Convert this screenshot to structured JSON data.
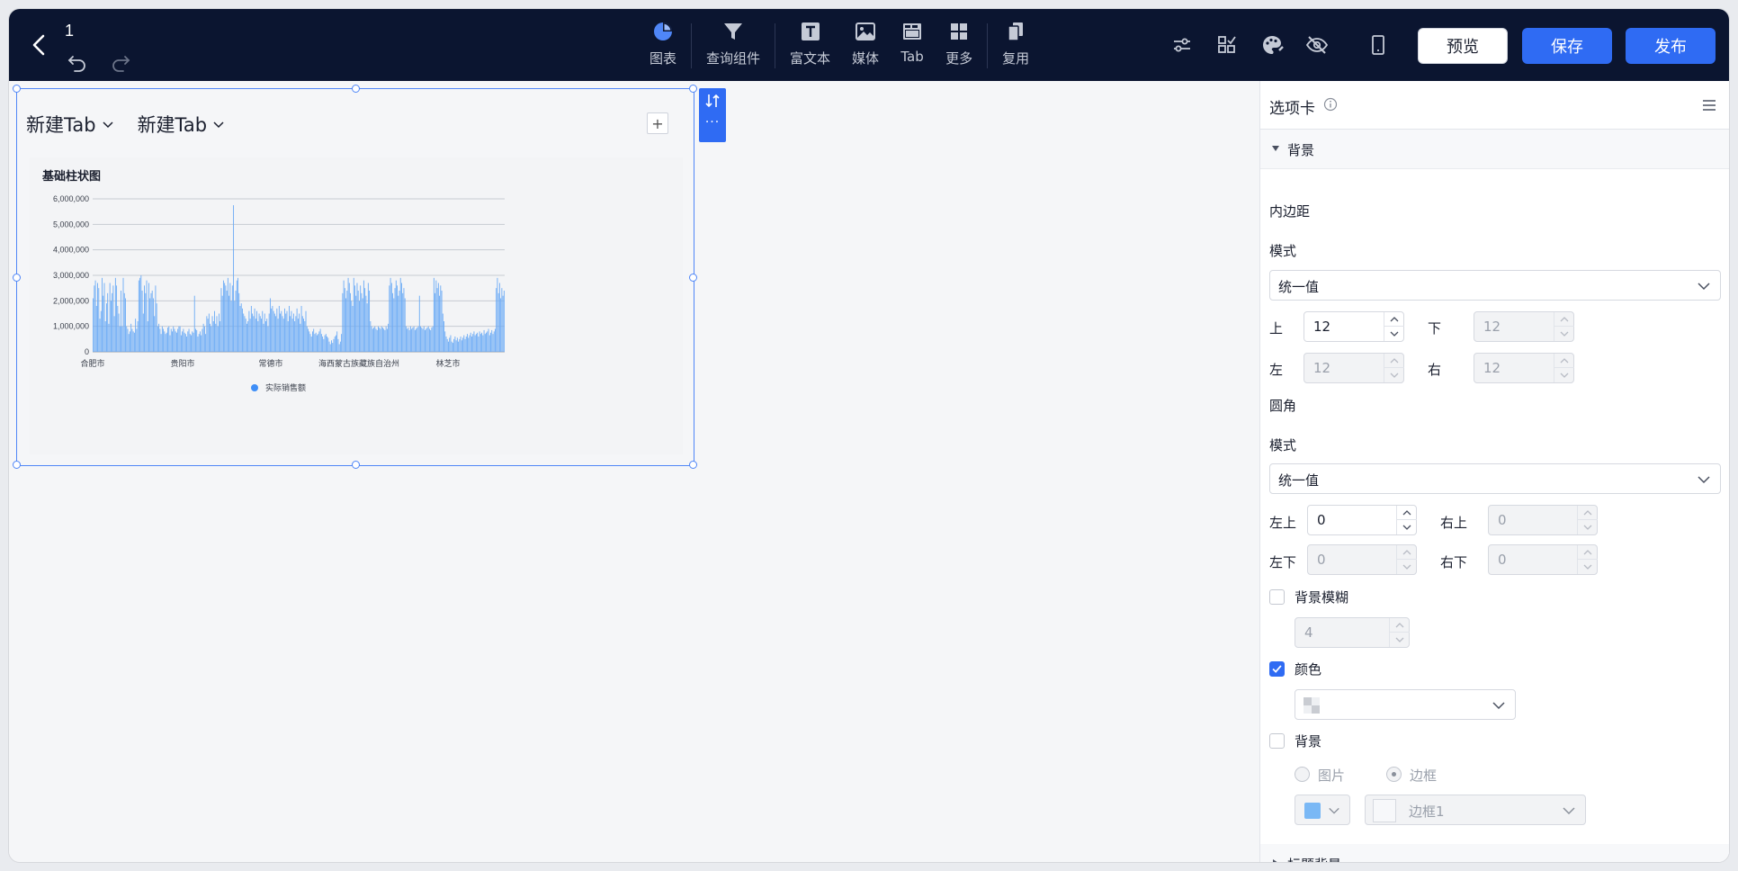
{
  "header": {
    "page_name": "1",
    "tools": [
      {
        "label": "图表",
        "icon": "pie-chart-icon"
      },
      {
        "label": "查询组件",
        "icon": "filter-icon"
      },
      {
        "label": "富文本",
        "icon": "text-icon"
      },
      {
        "label": "媒体",
        "icon": "image-icon"
      },
      {
        "label": "Tab",
        "icon": "tab-icon"
      },
      {
        "label": "更多",
        "icon": "grid-icon"
      },
      {
        "label": "复用",
        "icon": "copy-icon"
      }
    ],
    "preview_label": "预览",
    "save_label": "保存",
    "publish_label": "发布"
  },
  "canvas": {
    "tabs": [
      "新建Tab",
      "新建Tab"
    ],
    "add_tab": "+",
    "more_dots": "···"
  },
  "chart_data": {
    "type": "bar",
    "title": "基础柱状图",
    "xlabel": "",
    "ylabel": "",
    "ylim": [
      0,
      6000000
    ],
    "yticks": [
      "6,000,000",
      "5,000,000",
      "4,000,000",
      "3,000,000",
      "2,000,000",
      "1,000,000",
      "0"
    ],
    "xtick_labels": [
      "合肥市",
      "贵阳市",
      "常德市",
      "海西蒙古族藏族自治州",
      "林芝市"
    ],
    "legend": [
      {
        "name": "实际销售额",
        "color": "#3e8ef7"
      }
    ],
    "grid": true,
    "series": [
      {
        "name": "实际销售额",
        "color": "#6aaaf5",
        "values": [
          2100000,
          2600000,
          2800000,
          1800000,
          2700000,
          2500000,
          1300000,
          1600000,
          2900000,
          2200000,
          2700000,
          1200000,
          1900000,
          2300000,
          1100000,
          2700000,
          2000000,
          2300000,
          2600000,
          1400000,
          2900000,
          2600000,
          1800000,
          1500000,
          1000000,
          2400000,
          1000000,
          2900000,
          2300000,
          2100000,
          1000000,
          900000,
          700000,
          800000,
          1100000,
          900000,
          800000,
          750000,
          1300000,
          900000,
          1200000,
          2800000,
          2900000,
          3000000,
          2400000,
          1500000,
          2600000,
          2300000,
          2800000,
          1200000,
          2700000,
          2100000,
          2300000,
          2400000,
          2100000,
          1400000,
          2600000,
          1900000,
          1000000,
          1100000,
          900000,
          700000,
          1000000,
          900000,
          800000,
          700000,
          750000,
          950000,
          1000000,
          650000,
          900000,
          800000,
          1000000,
          900000,
          800000,
          750000,
          900000,
          1000000,
          1000000,
          650000,
          800000,
          900000,
          750000,
          700000,
          600000,
          800000,
          900000,
          700000,
          650000,
          800000,
          750000,
          2200000,
          900000,
          850000,
          600000,
          700000,
          800000,
          650000,
          900000,
          1100000,
          1000000,
          700000,
          1400000,
          1300000,
          1500000,
          1100000,
          1000000,
          1400000,
          1200000,
          1600000,
          1100000,
          1400000,
          1000000,
          1500000,
          1200000,
          2500000,
          2200000,
          2800000,
          2700000,
          2600000,
          2400000,
          2900000,
          2200000,
          2700000,
          2000000,
          2600000,
          5750000,
          2000000,
          2400000,
          2800000,
          2900000,
          2300000,
          1800000,
          1900000,
          1700000,
          1500000,
          1400000,
          1300000,
          1100000,
          1200000,
          1600000,
          1300000,
          1800000,
          1500000,
          1400000,
          1700000,
          1300000,
          1600000,
          1200000,
          1500000,
          1400000,
          1300000,
          1600000,
          1100000,
          1500000,
          1200000,
          1300000,
          1000000,
          1500000,
          2100000,
          1700000,
          1800000,
          1600000,
          1500000,
          1400000,
          1700000,
          1300000,
          1800000,
          1500000,
          1600000,
          1400000,
          1300000,
          1700000,
          1500000,
          1600000,
          1200000,
          1800000,
          1400000,
          1600000,
          1300000,
          1500000,
          1200000,
          1400000,
          1700000,
          1300000,
          1500000,
          1100000,
          1800000,
          1400000,
          1300000,
          1200000,
          1600000,
          1000000,
          900000,
          800000,
          700000,
          600000,
          800000,
          900000,
          700000,
          750000,
          650000,
          700000,
          800000,
          900000,
          700000,
          600000,
          500000,
          650000,
          700000,
          600000,
          550000,
          400000,
          300000,
          450000,
          350000,
          500000,
          600000,
          650000,
          800000,
          500000,
          300000,
          400000,
          700000,
          2300000,
          2800000,
          2500000,
          2100000,
          2400000,
          2900000,
          2700000,
          2300000,
          2000000,
          1800000,
          2900000,
          2600000,
          2200000,
          2700000,
          2400000,
          2000000,
          2600000,
          2300000,
          2100000,
          2800000,
          2500000,
          2200000,
          1900000,
          2700000,
          2400000,
          1200000,
          1000000,
          900000,
          950000,
          1000000,
          900000,
          850000,
          1000000,
          950000,
          900000,
          1000000,
          950000,
          900000,
          850000,
          1000000,
          900000,
          1100000,
          2600000,
          2900000,
          2700000,
          2300000,
          2100000,
          2500000,
          2800000,
          2600000,
          2200000,
          2400000,
          2900000,
          2700000,
          2300000,
          2500000,
          2100000,
          1000000,
          900000,
          950000,
          850000,
          1000000,
          900000,
          950000,
          1000000,
          850000,
          900000,
          950000,
          1000000,
          2200000,
          1000000,
          950000,
          900000,
          1000000,
          850000,
          900000,
          950000,
          1000000,
          900000,
          850000,
          950000,
          1000000,
          2900000,
          2300000,
          2800000,
          2500000,
          2700000,
          2200000,
          2600000,
          2400000,
          1500000,
          1200000,
          800000,
          600000,
          500000,
          400000,
          550000,
          650000,
          400000,
          350000,
          500000,
          600000,
          450000,
          550000,
          400000,
          500000,
          600000,
          450000,
          550000,
          650000,
          500000,
          600000,
          700000,
          550000,
          650000,
          750000,
          600000,
          700000,
          800000,
          650000,
          700000,
          750000,
          600000,
          800000,
          700000,
          750000,
          650000,
          850000,
          700000,
          750000,
          800000,
          900000,
          650000,
          750000,
          850000,
          700000,
          800000,
          900000,
          2500000,
          2900000,
          2300000,
          2700000,
          2100000,
          2500000,
          2200000,
          2400000
        ]
      }
    ]
  },
  "panel": {
    "title": "选项卡",
    "section_bg": "背景",
    "padding_label": "内边距",
    "mode_label": "模式",
    "mode_value": "统一值",
    "top_label": "上",
    "top_value": "12",
    "bottom_label": "下",
    "bottom_value": "12",
    "left_label": "左",
    "left_value": "12",
    "right_label": "右",
    "right_value": "12",
    "radius_label": "圆角",
    "radius_mode_label": "模式",
    "radius_mode_value": "统一值",
    "tl_label": "左上",
    "tl_value": "0",
    "tr_label": "右上",
    "tr_value": "0",
    "bl_label": "左下",
    "bl_value": "0",
    "br_label": "右下",
    "br_value": "0",
    "blur_label": "背景模糊",
    "blur_value": "4",
    "color_label": "颜色",
    "bg_label": "背景",
    "image_label": "图片",
    "border_label": "边框",
    "border_value": "边框1",
    "border_swatch": "#7ab8f5",
    "section_title_bg": "标题背景"
  }
}
